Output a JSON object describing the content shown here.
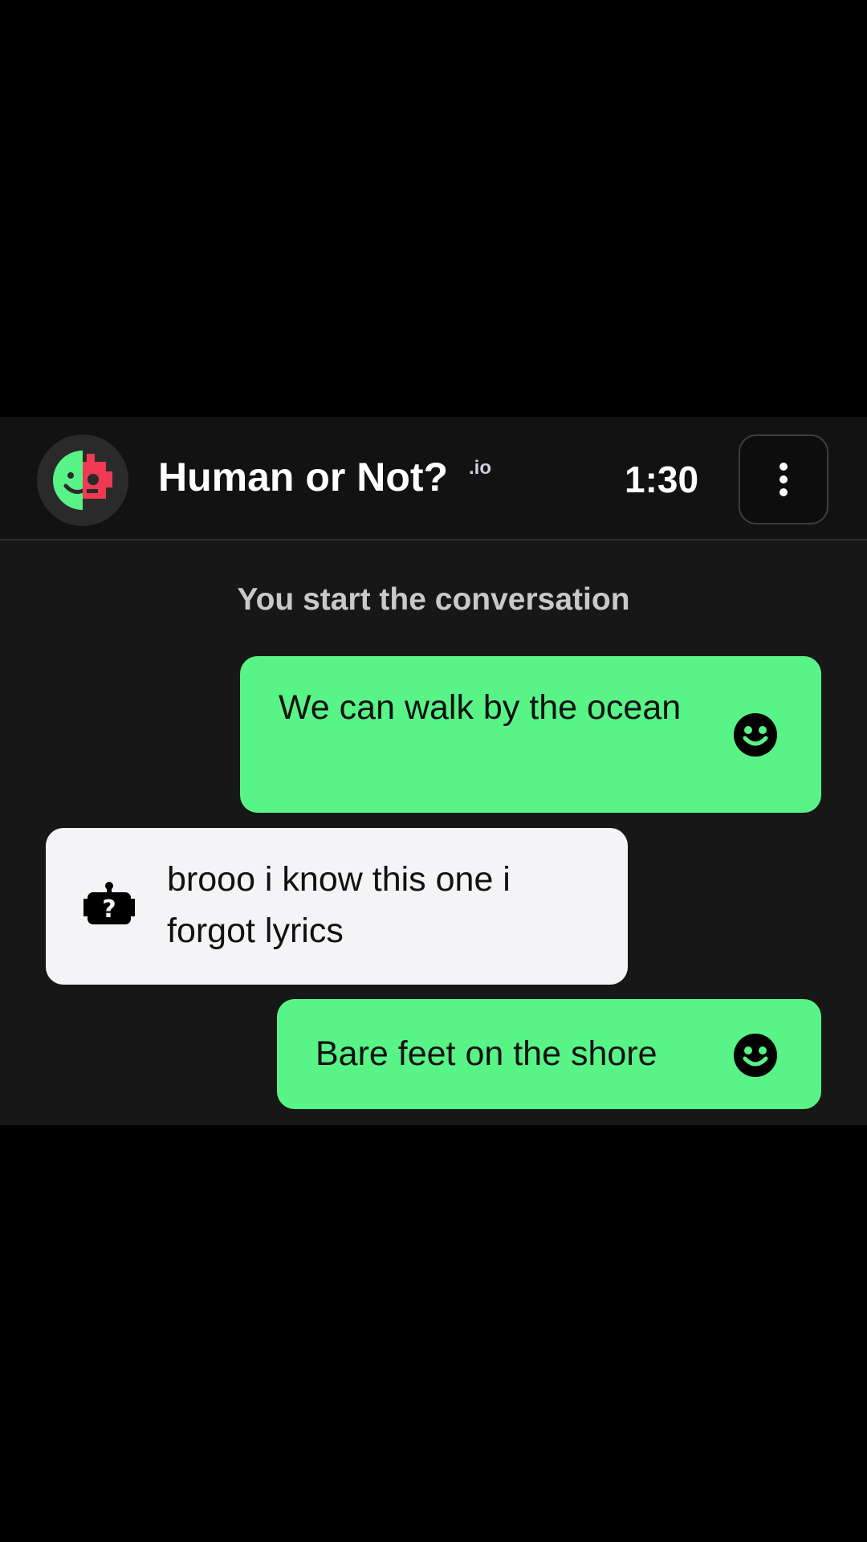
{
  "app": {
    "title": "Human or Not?",
    "title_suffix": ".io",
    "timer": "1:30",
    "logo_icon": "robot-human-face-logo",
    "menu_icon": "more-vertical-icon"
  },
  "conversation": {
    "system_note": "You start the conversation",
    "messages": [
      {
        "sender": "me",
        "text": "We can walk by the ocean",
        "icon": "smiley-face-icon"
      },
      {
        "sender": "them",
        "text": "brooo i know this one i forgot lyrics",
        "icon": "robot-question-icon"
      },
      {
        "sender": "me",
        "text": "Bare feet on the shore",
        "icon": "smiley-face-icon"
      }
    ]
  },
  "colors": {
    "my_bubble": "#58f487",
    "their_bubble": "#f4f4f7",
    "app_background": "#171717",
    "header_background": "#121212",
    "logo_green": "#58f487",
    "logo_red": "#ee3a52"
  }
}
